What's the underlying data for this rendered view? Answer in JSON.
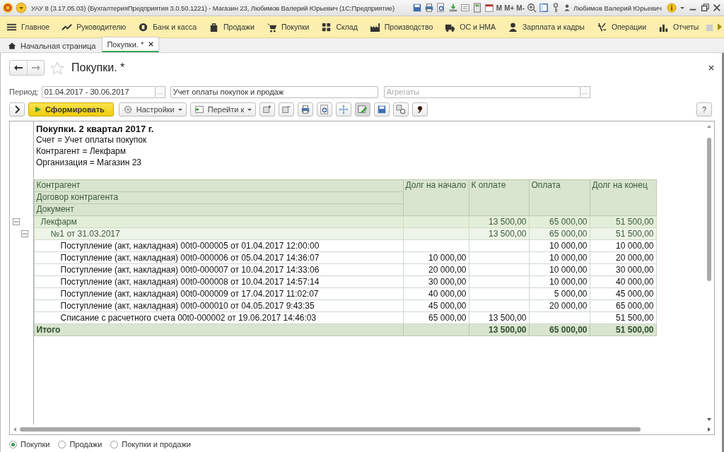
{
  "window": {
    "title": "УАУ 8 (3.17.05.03) (БухгалтерияПредприятия 3.0.50.1221) - Магазин 23, Любимов Валерий Юрьевич  (1С:Предприятие)",
    "memory_buttons": [
      "M",
      "M+",
      "M-"
    ],
    "user": "Любимов Валерий Юрьевич"
  },
  "sections": [
    {
      "label": "Главное"
    },
    {
      "label": "Руководителю"
    },
    {
      "label": "Банк и касса"
    },
    {
      "label": "Продажи"
    },
    {
      "label": "Покупки"
    },
    {
      "label": "Склад"
    },
    {
      "label": "Производство"
    },
    {
      "label": "ОС и НМА"
    },
    {
      "label": "Зарплата и кадры"
    },
    {
      "label": "Операции"
    },
    {
      "label": "Отчеты"
    }
  ],
  "tabs": [
    {
      "label": "Начальная страница",
      "selected": false
    },
    {
      "label": "Покупки. *",
      "selected": true
    }
  ],
  "form": {
    "title": "Покупки. *",
    "period": {
      "label": "Период:",
      "value": "01.04.2017 - 30.06.2017",
      "button": "..."
    },
    "account": {
      "value": "Учет оплаты покупок и продаж"
    },
    "aggregates": {
      "placeholder": "Агрегаты",
      "button": "..."
    }
  },
  "toolbar": {
    "generate": "Сформировать",
    "settings": "Настройки",
    "goto": "Перейти к",
    "help": "?"
  },
  "report": {
    "title": "Покупки. 2 квартал 2017 г.",
    "filters": [
      "Счет = Учет оплаты покупок",
      "Контрагент = Лекфарм",
      "Организация = Магазин 23"
    ],
    "group_headers": [
      "Контрагент",
      "Договор контрагента",
      "Документ"
    ],
    "columns": [
      "Долг на начало",
      "К оплате",
      "Оплата",
      "Долг на конец"
    ],
    "rows": [
      {
        "kind": "group",
        "label": "Лекфарм",
        "values": {
          "to_pay": "13 500,00",
          "paid": "65 000,00",
          "end": "51 500,00"
        },
        "expanded": true,
        "children": [
          {
            "kind": "group",
            "label": "№1 от 31.03.2017",
            "values": {
              "to_pay": "13 500,00",
              "paid": "65 000,00",
              "end": "51 500,00"
            },
            "expanded": true,
            "children": [
              {
                "kind": "document",
                "label": "Поступление (акт, накладная) 00t0-000005 от 01.04.2017 12:00:00",
                "values": {
                  "paid": "10 000,00",
                  "end": "10 000,00"
                }
              },
              {
                "kind": "document",
                "label": "Поступление (акт, накладная) 00t0-000006 от 05.04.2017 14:36:07",
                "values": {
                  "start": "10 000,00",
                  "paid": "10 000,00",
                  "end": "20 000,00"
                }
              },
              {
                "kind": "document",
                "label": "Поступление (акт, накладная) 00t0-000007 от 10.04.2017 14:33:06",
                "values": {
                  "start": "20 000,00",
                  "paid": "10 000,00",
                  "end": "30 000,00"
                }
              },
              {
                "kind": "document",
                "label": "Поступление (акт, накладная) 00t0-000008 от 10.04.2017 14:57:14",
                "values": {
                  "start": "30 000,00",
                  "paid": "10 000,00",
                  "end": "40 000,00"
                }
              },
              {
                "kind": "document",
                "label": "Поступление (акт, накладная) 00t0-000009 от 17.04.2017 11:02:07",
                "values": {
                  "start": "40 000,00",
                  "paid": "5 000,00",
                  "end": "45 000,00"
                }
              },
              {
                "kind": "document",
                "label": "Поступление (акт, накладная) 00t0-000010 от 04.05.2017 9:43:35",
                "values": {
                  "start": "45 000,00",
                  "paid": "20 000,00",
                  "end": "65 000,00"
                }
              },
              {
                "kind": "document",
                "label": "Списание с расчетного счета 00t0-000002 от 19.06.2017 14:46:03",
                "values": {
                  "start": "65 000,00",
                  "to_pay": "13 500,00",
                  "end": "51 500,00"
                }
              }
            ]
          }
        ]
      }
    ],
    "total": {
      "label": "Итого",
      "values": {
        "to_pay": "13 500,00",
        "paid": "65 000,00",
        "end": "51 500,00"
      }
    }
  },
  "radios": [
    {
      "label": "Покупки",
      "selected": true
    },
    {
      "label": "Продажи",
      "selected": false
    },
    {
      "label": "Покупки и продажи",
      "selected": false
    }
  ]
}
